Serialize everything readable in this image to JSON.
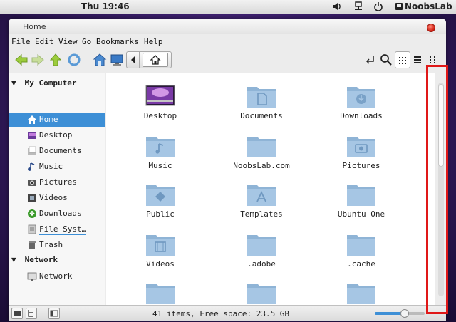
{
  "panel": {
    "clock": "Thu 19:46",
    "username": "NoobsLab"
  },
  "window": {
    "title": "Home"
  },
  "menu": {
    "items": [
      "File",
      "Edit",
      "View",
      "Go",
      "Bookmarks",
      "Help"
    ]
  },
  "sidebar": {
    "sections": [
      {
        "title": "My Computer",
        "items": [
          {
            "label": "Home",
            "icon": "home-icon",
            "selected": true
          },
          {
            "label": "Desktop",
            "icon": "desktop-icon"
          },
          {
            "label": "Documents",
            "icon": "documents-icon"
          },
          {
            "label": "Music",
            "icon": "music-icon"
          },
          {
            "label": "Pictures",
            "icon": "pictures-icon"
          },
          {
            "label": "Videos",
            "icon": "videos-icon"
          },
          {
            "label": "Downloads",
            "icon": "downloads-icon"
          },
          {
            "label": "File Syst…",
            "icon": "filesystem-icon"
          },
          {
            "label": "Trash",
            "icon": "trash-icon"
          }
        ]
      },
      {
        "title": "Network",
        "items": [
          {
            "label": "Network",
            "icon": "network-icon"
          }
        ]
      }
    ]
  },
  "files": [
    {
      "label": "Desktop",
      "icon": "desktop-folder-icon"
    },
    {
      "label": "Documents",
      "icon": "documents-folder-icon"
    },
    {
      "label": "Downloads",
      "icon": "downloads-folder-icon"
    },
    {
      "label": "Music",
      "icon": "music-folder-icon"
    },
    {
      "label": "NoobsLab.com",
      "icon": "folder-icon"
    },
    {
      "label": "Pictures",
      "icon": "pictures-folder-icon"
    },
    {
      "label": "Public",
      "icon": "public-folder-icon"
    },
    {
      "label": "Templates",
      "icon": "templates-folder-icon"
    },
    {
      "label": "Ubuntu One",
      "icon": "folder-icon"
    },
    {
      "label": "Videos",
      "icon": "videos-folder-icon"
    },
    {
      "label": ".adobe",
      "icon": "folder-icon"
    },
    {
      "label": ".cache",
      "icon": "folder-icon"
    },
    {
      "label": "",
      "icon": "folder-icon"
    },
    {
      "label": "",
      "icon": "folder-icon"
    },
    {
      "label": "",
      "icon": "locked-folder-icon"
    }
  ],
  "status": {
    "text": "41 items, Free space: 23.5 GB",
    "zoom_level": 0.62
  },
  "colors": {
    "accent": "#3d8fd6",
    "folder": "#8fb4d6",
    "highlight": "#e01818"
  }
}
